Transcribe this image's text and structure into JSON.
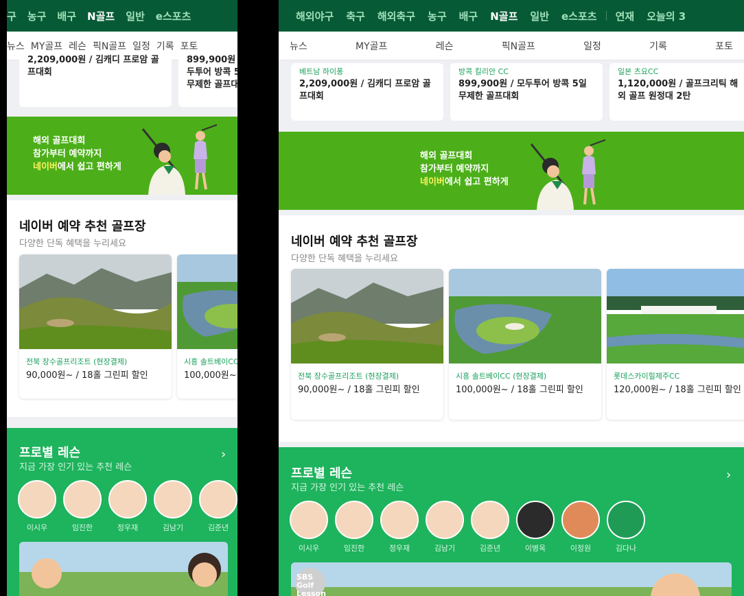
{
  "nav": {
    "narrow_items": [
      "구",
      "농구",
      "배구",
      "N골프",
      "일반",
      "e스포츠"
    ],
    "wide_items": [
      "해외야구",
      "축구",
      "해외축구",
      "농구",
      "배구",
      "N골프",
      "일반",
      "e스포츠",
      "연재",
      "오늘의 3"
    ],
    "active": "N골프"
  },
  "subnav": {
    "narrow_items": [
      "뉴스",
      "MY골프",
      "레슨",
      "픽N골프",
      "일정",
      "기록",
      "포토"
    ],
    "wide_items": [
      "뉴스",
      "MY골프",
      "레슨",
      "픽N골프",
      "일정",
      "기록",
      "포토"
    ]
  },
  "deals": [
    {
      "loc": "베트남 하이퐁",
      "price": "2,209,000원 / 김캐디 프로암 골프대회"
    },
    {
      "loc": "방콕 킬리안 CC",
      "price": "899,900원 / 모두투어 방콕 5일 무제한 골프대회"
    },
    {
      "loc": "일본 츠요CC",
      "price": "1,120,000원 / 골프크리틱 해외 골프 원정대 2탄"
    }
  ],
  "banner": {
    "line1": "해외 골프대회",
    "line2": "참가부터 예약까지",
    "line3_highlight": "네이버",
    "line3_rest": "에서 쉽고 편하게"
  },
  "recommend": {
    "title": "네이버 예약 추천 골프장",
    "subtitle": "다양한 단독 혜택을 누리세요",
    "courses": [
      {
        "loc": "전북 장수골프리조트 (현장결제)",
        "price": "90,000원~ / 18홀 그린피 할인"
      },
      {
        "loc": "시흥 솔트베이CC (현장결제)",
        "price": "100,000원~ / 18홀 그린피 할인"
      },
      {
        "loc": "롯데스카이힐제주CC",
        "price": "120,000원~ / 18홀 그린피 할인"
      }
    ]
  },
  "lesson": {
    "title": "프로별 레슨",
    "subtitle": "지금 가장 인기 있는 추천 레슨",
    "arrow": "›",
    "pros": [
      "이시우",
      "임진한",
      "정우재",
      "김남기",
      "김준년",
      "이병옥",
      "이정원",
      "김다나"
    ],
    "video_badge": "SBS Golf Lesson"
  },
  "colors": {
    "nav_bg": "#075a36",
    "banner_green": "#4caf19",
    "lesson_green": "#1eb35d",
    "accent_text": "#19a05a"
  }
}
